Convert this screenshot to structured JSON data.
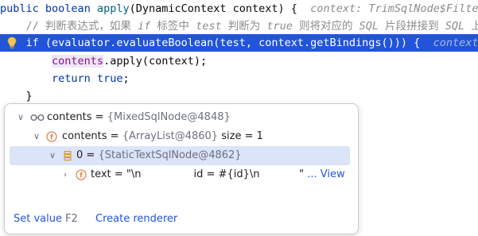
{
  "code": {
    "line1": {
      "kw1": "public",
      "kw2": "boolean",
      "fn": "apply",
      "rest": "(DynamicContext context) {",
      "hint": "context: TrimSqlNode$FilteredDynamicContext"
    },
    "line2": {
      "comment_a": "// 判断表达式，如果 ",
      "comment_b": "if",
      "comment_c": " 标签中 ",
      "comment_d": "test",
      "comment_e": " 判断为 ",
      "comment_f": "true",
      "comment_g": " 则将对应的 ",
      "comment_h": "SQL",
      "comment_i": " 片段拼接到 ",
      "comment_j": "SQL",
      "comment_k": " 上"
    },
    "line3": {
      "kw": "if",
      "rest": " (evaluator.evaluateBoolean(test, context.getBindings())) {",
      "hint": "context: TrimSq"
    },
    "line4": {
      "var": "contents",
      "rest": ".apply(context);"
    },
    "line5": {
      "kw1": "return",
      "kw2": "true",
      "rest": ";"
    },
    "line6": {
      "brace": "}"
    }
  },
  "debug_popup": {
    "root": {
      "name": "contents",
      "eq": " = ",
      "value": "{MixedSqlNode@4848}"
    },
    "child": {
      "name": "contents",
      "eq": " = ",
      "value": "{ArrayList@4860}",
      "size": "size = 1"
    },
    "item": {
      "name": "0",
      "eq": " = ",
      "value": "{StaticTextSqlNode@4862}"
    },
    "leaf": {
      "name": "text",
      "eq": " = ",
      "value": "\"\\n                id = #{id}\\n            \"",
      "view_link": "... View"
    },
    "footer": {
      "set_value": "Set value",
      "shortcut": "F2",
      "create_renderer": "Create renderer"
    }
  },
  "colors": {
    "selection": "#2154d9",
    "link": "#2154d9",
    "keyword": "#0033b3",
    "field": "#871094"
  }
}
